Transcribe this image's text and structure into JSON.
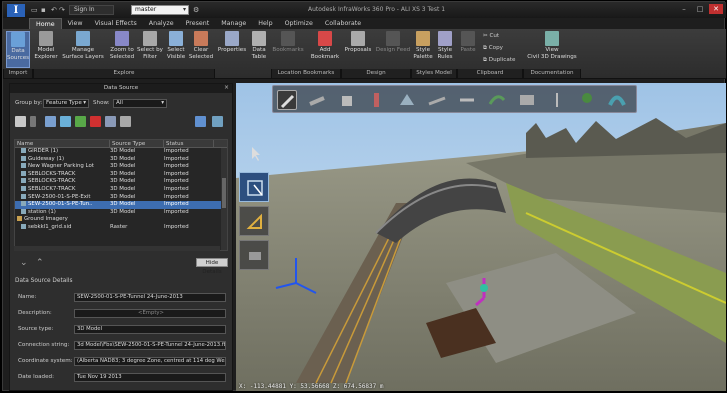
{
  "app": {
    "title": "Autodesk InfraWorks 360 Pro - ALI XS 3 Test 1",
    "logo": "I",
    "sign_in": "Sign In",
    "model_combo": "master"
  },
  "tabs": [
    "Home",
    "View",
    "Visual Effects",
    "Analyze",
    "Present",
    "Manage",
    "Help",
    "Optimize",
    "Collaborate"
  ],
  "ribbon": {
    "import": {
      "data_sources": "Data\nSources",
      "panel": "Import"
    },
    "explore": {
      "model_explorer": "Model\nExplorer",
      "manage_surface_layers": "Manage\nSurface Layers",
      "zoom_to_selected": "Zoom to\nSelected",
      "select_by_filter": "Select by\nFilter",
      "select_visible": "Select\nVisible",
      "clear_selected": "Clear\nSelected",
      "panel": "Explore"
    },
    "properties": "Properties",
    "data_table": "Data\nTable",
    "bookmarks": "Bookmarks",
    "location_panel": "Location Bookmarks",
    "add_bookmark": "Add\nBookmark",
    "design": {
      "proposals": "Proposals",
      "design_feed": "Design Feed",
      "panel": "Design"
    },
    "styles": {
      "style_palette": "Style\nPalette",
      "style_rules": "Style\nRules",
      "panel": "Styles Model"
    },
    "clipboard": {
      "paste": "Paste",
      "cut": "Cut",
      "copy": "Copy",
      "duplicate": "Duplicate",
      "panel": "Clipboard"
    },
    "documentation": {
      "view_civil3d": "View\nCivil 3D Drawings",
      "panel": "Documentation"
    }
  },
  "data_source_panel": {
    "title": "Data Source",
    "close": "×",
    "group_by_label": "Group by:",
    "group_by_value": "Feature Type",
    "show_label": "Show:",
    "show_value": "All",
    "columns": [
      "Name",
      "Source Type",
      "Status"
    ],
    "rows": [
      {
        "name": "GIRDER (1)",
        "type": "3D Model",
        "status": "Imported",
        "selected": false
      },
      {
        "name": "Guideway (1)",
        "type": "3D Model",
        "status": "Imported",
        "selected": false
      },
      {
        "name": "New Wagner Parking Lot",
        "type": "3D Model",
        "status": "Imported",
        "selected": false
      },
      {
        "name": "SEBLOCKS-TRACK",
        "type": "3D Model",
        "status": "Imported",
        "selected": false
      },
      {
        "name": "SEBLOCKS-TRACK",
        "type": "3D Model",
        "status": "Imported",
        "selected": false
      },
      {
        "name": "SEBLOCK7-TRACK",
        "type": "3D Model",
        "status": "Imported",
        "selected": false
      },
      {
        "name": "SEW-2500-01-S-PE-Exit",
        "type": "3D Model",
        "status": "Imported",
        "selected": false
      },
      {
        "name": "SEW-2500-01-S-PE-Tun..",
        "type": "3D Model",
        "status": "Imported",
        "selected": true
      },
      {
        "name": "station (1)",
        "type": "3D Model",
        "status": "Imported",
        "selected": false
      },
      {
        "name": "Ground Imagery",
        "type": "",
        "status": "",
        "selected": false
      },
      {
        "name": "sebkkl1_grid.sid",
        "type": "Raster",
        "status": "Imported",
        "selected": false
      }
    ],
    "hide_details": "Hide Details",
    "details_title": "Data Source Details",
    "details": [
      {
        "label": "Name:",
        "value": "SEW-2500-01-S-PE-Tunnel 24-June-2013"
      },
      {
        "label": "Description:",
        "value": "<Empty>"
      },
      {
        "label": "Source type:",
        "value": "3D Model"
      },
      {
        "label": "Connection string:",
        "value": "3d Model\\Fbx\\SEW-2500-01-S-PE-Tunnel 24-June-2013.fbx"
      },
      {
        "label": "Coordinate system:",
        "value": "(Alberta NAD83; 3 degree Zone, centred at 114 deg West)"
      },
      {
        "label": "Date loaded:",
        "value": "Tue Nov 19 2013"
      }
    ]
  },
  "viewport": {
    "coords": "X: -113.44881  Y: 53.56668  Z: 674.56837 m"
  },
  "colors": {
    "accent": "#3d6db0",
    "ribbon": "#333333",
    "panel": "#2e2e2e",
    "sky": "#bcd6ee",
    "ground": "#8a8a78"
  }
}
